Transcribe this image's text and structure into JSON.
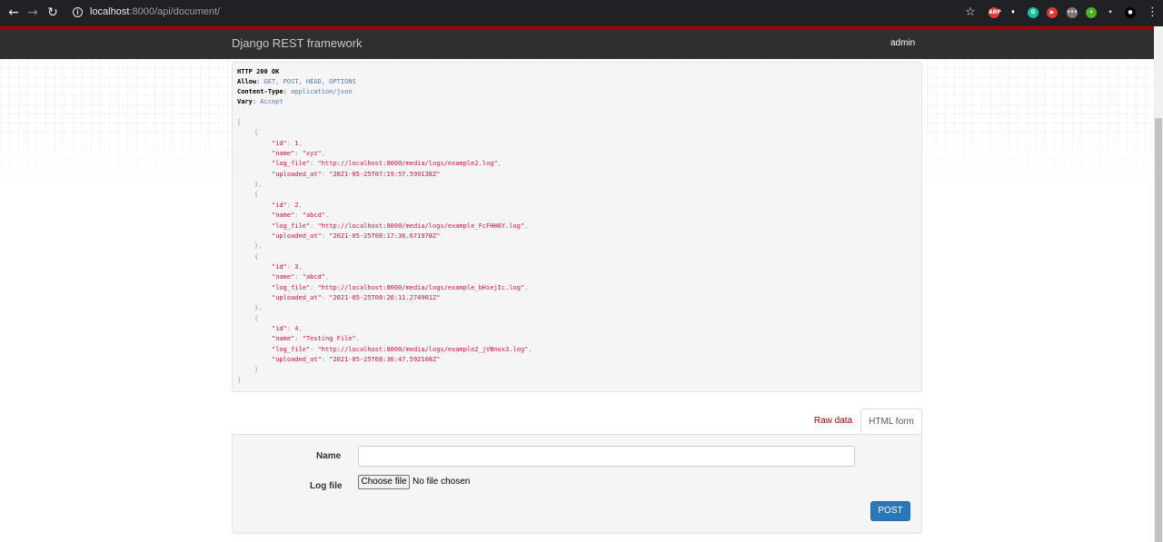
{
  "browser": {
    "url_host": "localhost",
    "url_rest": ":8000/api/document/",
    "icons": [
      "back-icon",
      "forward-icon",
      "reload-icon",
      "info-icon",
      "star-icon",
      "menu-icon"
    ],
    "extensions": [
      {
        "name": "adblock-extension-icon",
        "label": "ABP",
        "color": "#e13838"
      },
      {
        "name": "tower-extension-icon",
        "label": "♦",
        "color": "#202124"
      },
      {
        "name": "grammarly-extension-icon",
        "label": "G",
        "color": "#15c39a"
      },
      {
        "name": "video-extension-icon",
        "label": "▶",
        "color": "#e13838"
      },
      {
        "name": "dots-extension-icon",
        "label": "•••",
        "color": "#7a7a7a"
      },
      {
        "name": "plus-extension-icon",
        "label": "+",
        "color": "#4caf1f"
      },
      {
        "name": "puzzle-extension-icon",
        "label": "✦",
        "color": "#202124"
      },
      {
        "name": "profile-avatar-icon",
        "label": "●",
        "color": "#000000"
      }
    ]
  },
  "navbar": {
    "brand": "Django REST framework",
    "user": "admin"
  },
  "response": {
    "status_line": "HTTP 200 OK",
    "headers": [
      {
        "name": "Allow",
        "value": "GET, POST, HEAD, OPTIONS"
      },
      {
        "name": "Content-Type",
        "value": "application/json"
      },
      {
        "name": "Vary",
        "value": "Accept"
      }
    ],
    "items": [
      {
        "id": "1",
        "name": "\"xyz\"",
        "log_file": "\"http://localhost:8000/media/logs/example2.log\"",
        "uploaded_at": "\"2021-05-25T07:19:57.599138Z\""
      },
      {
        "id": "2",
        "name": "\"abcd\"",
        "log_file": "\"http://localhost:8000/media/logs/example_FcFHH6Y.log\"",
        "uploaded_at": "\"2021-05-25T08:17:36.671978Z\""
      },
      {
        "id": "3",
        "name": "\"abcd\"",
        "log_file": "\"http://localhost:8000/media/logs/example_bHiejIc.log\"",
        "uploaded_at": "\"2021-05-25T08:20:11.274901Z\""
      },
      {
        "id": "4",
        "name": "\"Testing File\"",
        "log_file": "\"http://localhost:8000/media/logs/example2_jVBnox3.log\"",
        "uploaded_at": "\"2021-05-25T08:36:47.592108Z\""
      }
    ]
  },
  "tabs": {
    "raw": "Raw data",
    "html": "HTML form"
  },
  "form": {
    "name_label": "Name",
    "name_value": "",
    "logfile_label": "Log file",
    "choose_file_label": "Choose file",
    "file_status": "No file chosen",
    "post_label": "POST"
  },
  "colors": {
    "accent_red": "#a30000",
    "navbar_bg": "#2f2f2f",
    "post_button": "#2c77b9"
  }
}
